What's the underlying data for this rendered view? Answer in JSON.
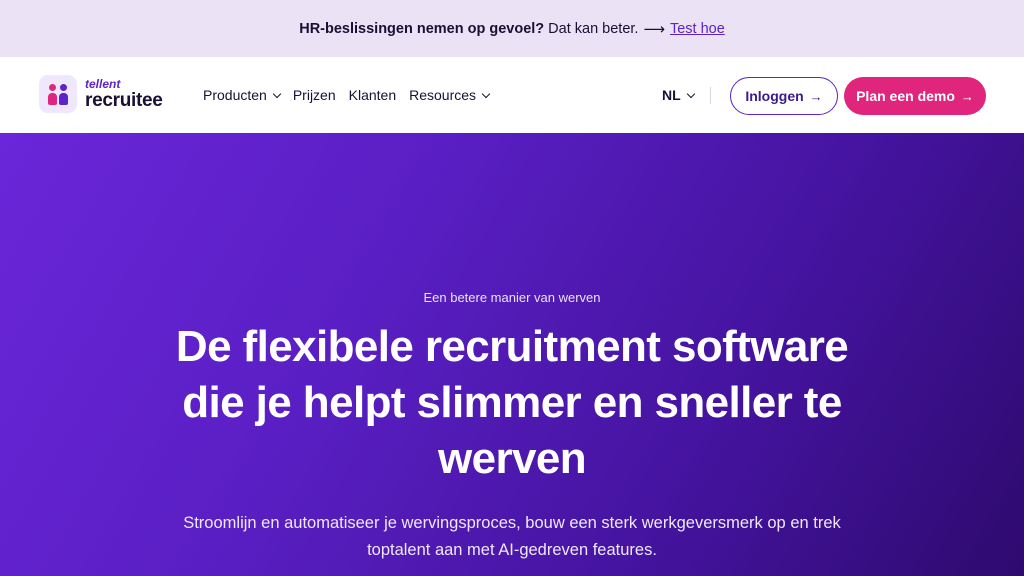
{
  "announcement": {
    "bold_text": "HR-beslissingen nemen op gevoel?",
    "text": "Dat kan beter.",
    "arrow": "⟶",
    "link_text": "Test hoe"
  },
  "nav": {
    "logo": {
      "top": "tellent",
      "bottom": "recruitee"
    },
    "menu": [
      {
        "label": "Producten",
        "has_dropdown": true
      },
      {
        "label": "Prijzen",
        "has_dropdown": false
      },
      {
        "label": "Klanten",
        "has_dropdown": false
      },
      {
        "label": "Resources",
        "has_dropdown": true
      }
    ],
    "language": "NL",
    "login_label": "Inloggen",
    "demo_label": "Plan een demo",
    "button_arrow": "→"
  },
  "hero": {
    "eyebrow": "Een betere manier van werven",
    "title": "De flexibele recruitment software die je helpt slimmer en sneller te werven",
    "subtitle": "Stroomlijn en automatiseer je wervingsproces, bouw een sterk werkgeversmerk op en trek toptalent aan met AI-gedreven features."
  },
  "colors": {
    "brand_purple": "#5b23c9",
    "brand_pink": "#e0267c",
    "announcement_bg": "#ece2f6"
  }
}
